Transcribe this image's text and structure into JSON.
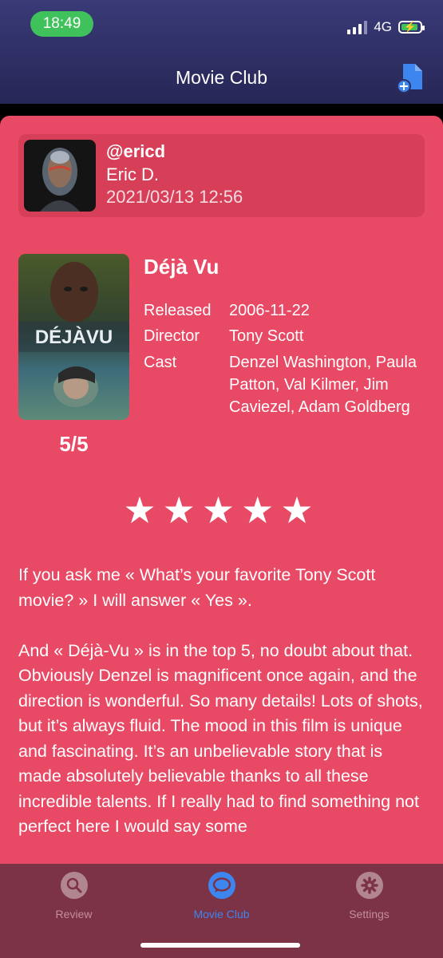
{
  "status": {
    "time": "18:49",
    "network": "4G"
  },
  "nav": {
    "title": "Movie Club"
  },
  "review": {
    "handle": "@ericd",
    "name": "Eric D.",
    "date": "2021/03/13 12:56",
    "score": "5/5",
    "stars": "★★★★★",
    "paragraphs": [
      "If you ask me « What’s your favorite Tony Scott movie? » I will answer « Yes ».",
      "And « Déjà-Vu » is in the top 5, no doubt about that. Obviously Denzel is magnificent once again, and the direction is wonderful. So many details! Lots of shots, but it’s always fluid. The mood in this film is unique and fascinating. It’s an unbelievable story that is made absolutely believable thanks to all these incredible talents. If I really had to find something not perfect here I would say some"
    ]
  },
  "movie": {
    "title": "Déjà Vu",
    "poster_text": "DÉJÀVU",
    "released_label": "Released",
    "released": "2006-11-22",
    "director_label": "Director",
    "director": "Tony Scott",
    "cast_label": "Cast",
    "cast": "Denzel Washington, Paula Patton, Val Kilmer, Jim Caviezel, Adam Goldberg"
  },
  "tabs": [
    {
      "label": "Review",
      "icon": "search-icon",
      "active": false
    },
    {
      "label": "Movie Club",
      "icon": "chat-bubble-icon",
      "active": true
    },
    {
      "label": "Settings",
      "icon": "gear-icon",
      "active": false
    }
  ],
  "colors": {
    "card": "#e84964",
    "user_box": "#d63f57",
    "tabbar": "#7d3346",
    "accent": "#3d86f0",
    "time_pill": "#3fc15b",
    "header": "#2e2e66"
  }
}
